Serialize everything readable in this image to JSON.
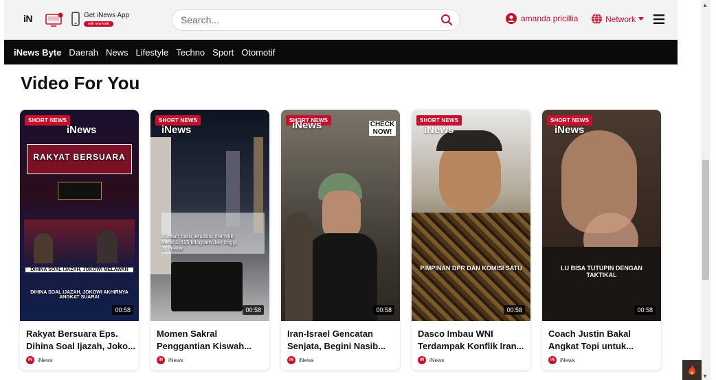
{
  "header": {
    "logo_text": "iN",
    "app_title": "Get iNews App",
    "app_sub": "with new look!",
    "search_placeholder": "Search...",
    "user_name": "amanda pricillia",
    "network_label": "Network"
  },
  "nav": {
    "items": [
      {
        "label": "iNews Byte"
      },
      {
        "label": "Daerah"
      },
      {
        "label": "News"
      },
      {
        "label": "Lifestyle"
      },
      {
        "label": "Techno"
      },
      {
        "label": "Sport"
      },
      {
        "label": "Otomotif"
      }
    ]
  },
  "section_title": "Video For You",
  "cards": [
    {
      "badge": "SHORT NEWS",
      "brand": "iNews",
      "duration": "00:58",
      "title_line1": "Rakyat Bersuara Eps.",
      "title_line2": "Dihina Soal Ijazah, Joko...",
      "source": "iNews",
      "caption_a": "RAKYAT BERSUARA",
      "caption_b": "DIHINA SOAL IJAZAH, JOKOWI MELAWAN",
      "caption_c": "DIHINA SOAL IJAZAH, JOKOWI AKHIRNYA ANGKAT SUARA!"
    },
    {
      "badge": "SHORT NEWS",
      "brand": "iNews",
      "duration": "00:58",
      "title_line1": "Momen Sakral",
      "title_line2": "Penggantian Kiswah...",
      "source": "iNews",
      "caption_a": "Kiswah baru tersebut memiliki berat 1.415 kilogram dan tinggi 14 meter."
    },
    {
      "badge": "SHORT NEWS",
      "brand": "iNews",
      "duration": "00:58",
      "title_line1": "Iran-Israel Gencatan",
      "title_line2": "Senjata, Begini Nasib...",
      "source": "iNews",
      "caption_a": "CHECK NOW!"
    },
    {
      "badge": "SHORT NEWS",
      "brand": "iNews",
      "duration": "00:58",
      "title_line1": "Dasco Imbau WNI",
      "title_line2": "Terdampak Konflik Iran...",
      "source": "iNews",
      "caption_a": "PIMPINAN DPR DAN KOMISI SATU"
    },
    {
      "badge": "SHORT NEWS",
      "brand": "iNews",
      "duration": "00:58",
      "title_line1": "Coach Justin Bakal",
      "title_line2": "Angkat Topi untuk...",
      "source": "iNews",
      "caption_a": "LU BISA TUTUPIN DENGAN TAKTIKAL"
    }
  ],
  "colors": {
    "brand_red": "#c8102e",
    "nav_bg": "#0a0a0a",
    "header_bg": "#f3f3f3"
  }
}
